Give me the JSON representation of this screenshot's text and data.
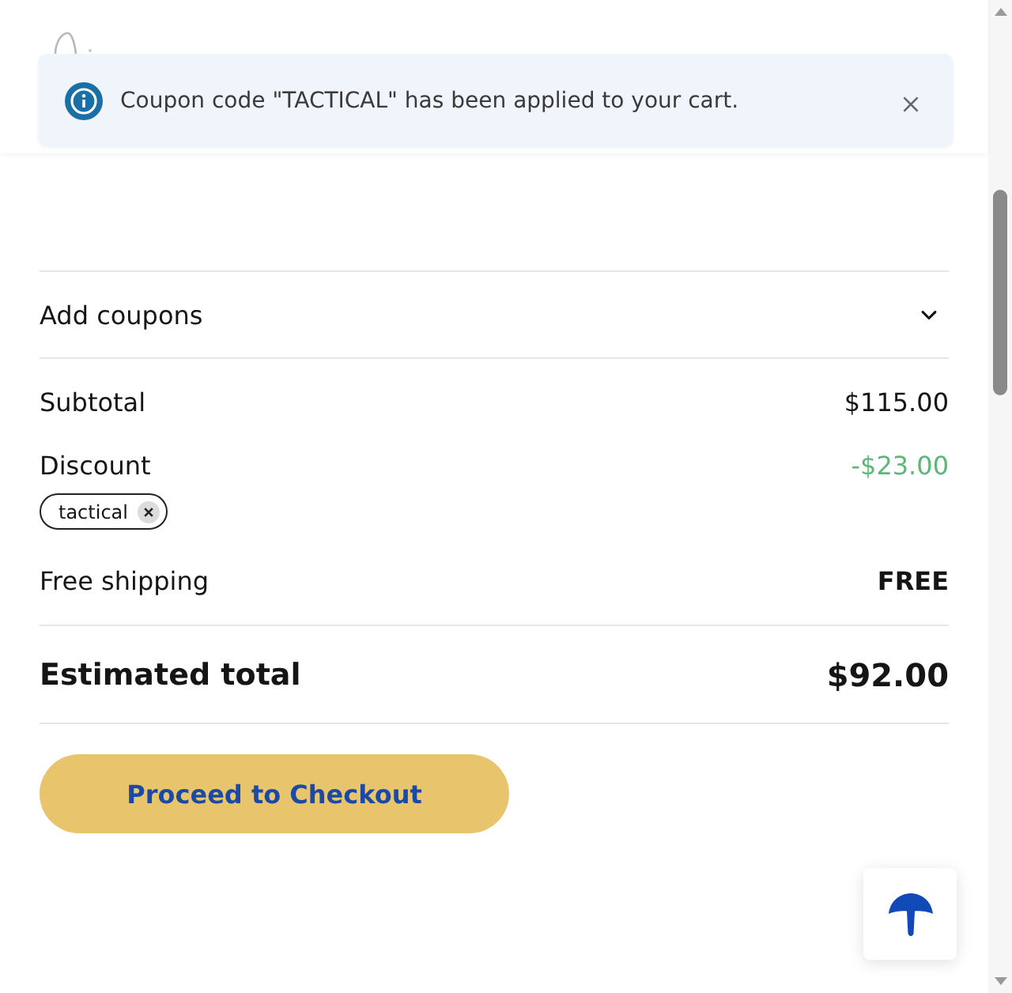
{
  "toast": {
    "message": "Coupon code \"TACTICAL\" has been applied to your cart."
  },
  "coupons": {
    "label": "Add coupons",
    "expanded": false
  },
  "summary": [
    {
      "kind": "amount",
      "label": "Subtotal",
      "value": "$115.00"
    },
    {
      "kind": "discount",
      "label": "Discount",
      "value": "-$23.00",
      "coupons": [
        {
          "code": "tactical"
        }
      ]
    },
    {
      "kind": "shipping",
      "label": "Free shipping",
      "value": "FREE"
    }
  ],
  "total": {
    "label": "Estimated total",
    "value": "$92.00"
  },
  "checkout_button": {
    "label": "Proceed to Checkout"
  }
}
